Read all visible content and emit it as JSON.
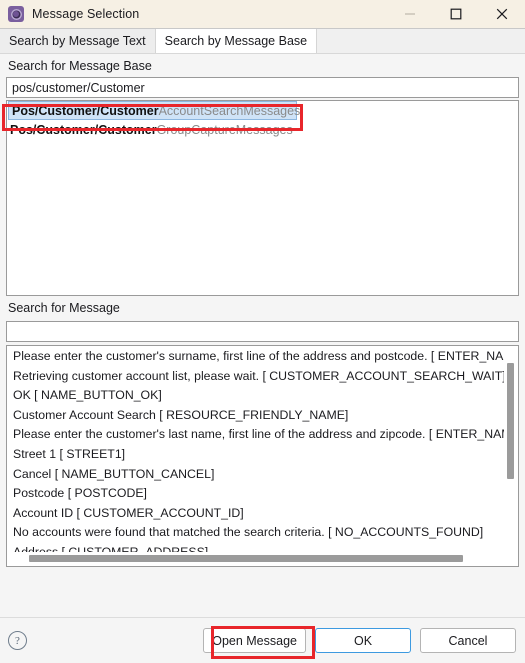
{
  "window": {
    "title": "Message Selection",
    "icon": "app-gear-icon",
    "controls": {
      "minimize": "–",
      "maximize": "□",
      "close": "✕"
    }
  },
  "tabs": [
    {
      "label": "Search by Message Text",
      "active": false
    },
    {
      "label": "Search by Message Base",
      "active": true
    }
  ],
  "message_base": {
    "label": "Search for Message Base",
    "search_value": "pos/customer/Customer",
    "search_placeholder": "",
    "results": [
      {
        "prefix": "Pos/Customer/Customer",
        "suffix": "AccountSearchMessages",
        "selected": true
      },
      {
        "prefix": "Pos/Customer/Customer",
        "suffix": "GroupCaptureMessages",
        "selected": false
      }
    ]
  },
  "message": {
    "label": "Search for Message",
    "search_value": "",
    "search_placeholder": "",
    "results": [
      "Please enter the customer's surname, first line of the address and postcode. [ ENTER_NAME_PR",
      "Retrieving customer account list, please wait. [ CUSTOMER_ACCOUNT_SEARCH_WAIT]",
      "OK [ NAME_BUTTON_OK]",
      "Customer Account Search [ RESOURCE_FRIENDLY_NAME]",
      "Please enter the customer's last name, first line of the address and zipcode. [ ENTER_NAME_PR",
      "Street 1 [ STREET1]",
      "Cancel [ NAME_BUTTON_CANCEL]",
      "Postcode [ POSTCODE]",
      "Account ID [ CUSTOMER_ACCOUNT_ID]",
      "No accounts were found that matched the search criteria. [ NO_ACCOUNTS_FOUND]",
      "Address [ CUSTOMER_ADDRESS]"
    ]
  },
  "footer": {
    "help_label": "?",
    "buttons": [
      {
        "label": "Open Message",
        "focused": false,
        "highlighted": true
      },
      {
        "label": "OK",
        "focused": true,
        "highlighted": false
      },
      {
        "label": "Cancel",
        "focused": false,
        "highlighted": false
      }
    ]
  },
  "colors": {
    "titlebar_bg": "#f6f0e4",
    "selection_bg": "#cfe3f7",
    "annotation": "#e8262b",
    "focus_border": "#3d9ae0"
  }
}
